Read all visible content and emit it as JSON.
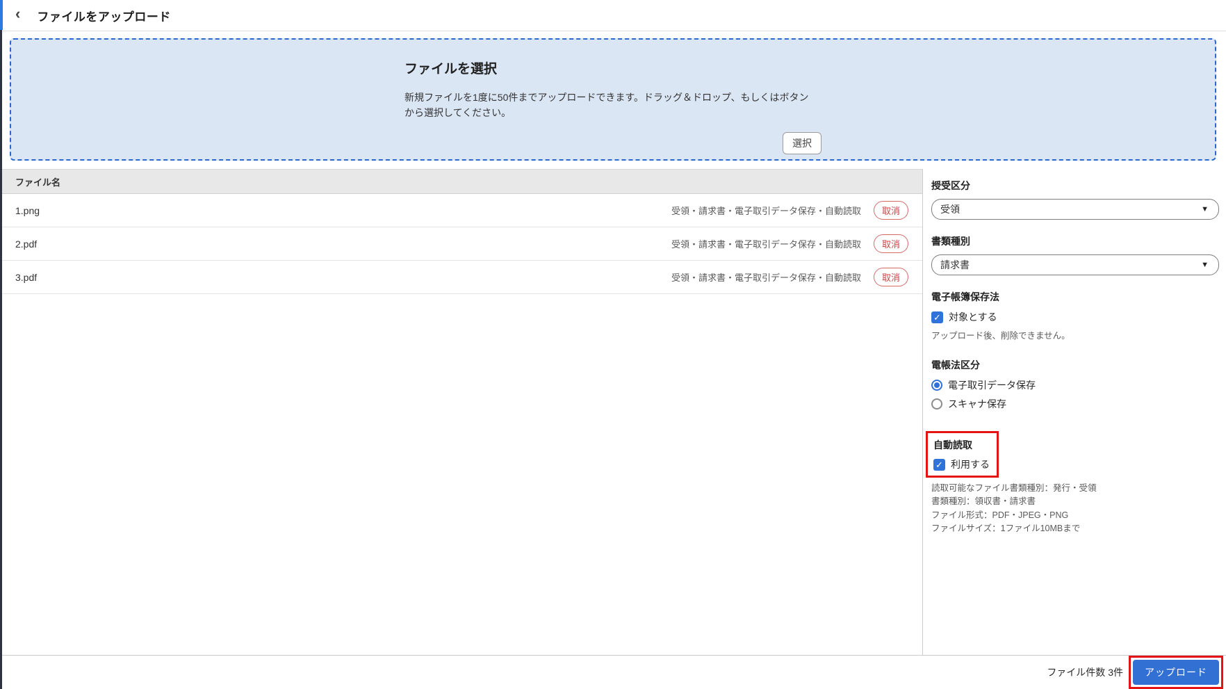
{
  "icons": {
    "back": "‹",
    "caret": "▼",
    "check": "✓"
  },
  "colors": {
    "accent_blue": "#2f72d9",
    "dropzone_bg": "#dbe6f5",
    "dropzone_border": "#2a68d0",
    "danger_red": "#cf4444",
    "highlight_red": "#e41414",
    "upload_button_bg": "#3370d4",
    "edge_blue": "#2b7ce2",
    "edge_dark": "#2e3340"
  },
  "header": {
    "title": "ファイルをアップロード"
  },
  "dropzone": {
    "title": "ファイルを選択",
    "description_line1": "新規ファイルを1度に50件までアップロードできます。ドラッグ＆ドロップ、もしくはボタン",
    "description_line2": "から選択してください。",
    "select_button": "選択"
  },
  "table": {
    "header": "ファイル名",
    "rows": [
      {
        "name": "1.png",
        "tags": "受領・請求書・電子取引データ保存・自動読取",
        "cancel": "取消"
      },
      {
        "name": "2.pdf",
        "tags": "受領・請求書・電子取引データ保存・自動読取",
        "cancel": "取消"
      },
      {
        "name": "3.pdf",
        "tags": "受領・請求書・電子取引データ保存・自動読取",
        "cancel": "取消"
      }
    ]
  },
  "panel": {
    "category": {
      "label": "授受区分",
      "value": "受領"
    },
    "doc_type": {
      "label": "書類種別",
      "value": "請求書"
    },
    "denshi_law": {
      "label": "電子帳簿保存法",
      "checkbox_label": "対象とする",
      "checked": true,
      "note": "アップロード後、削除できません。"
    },
    "law_category": {
      "label": "電帳法区分",
      "options": [
        {
          "label": "電子取引データ保存",
          "selected": true
        },
        {
          "label": "スキャナ保存",
          "selected": false
        }
      ]
    },
    "auto_read": {
      "label": "自動読取",
      "checkbox_label": "利用する",
      "checked": true,
      "notes": [
        "読取可能なファイル書類種別：発行・受領",
        "書類種別：領収書・請求書",
        "ファイル形式：PDF・JPEG・PNG",
        "ファイルサイズ：1ファイル10MBまで"
      ]
    }
  },
  "footer": {
    "file_count": "ファイル件数 3件",
    "upload_button": "アップロード"
  }
}
